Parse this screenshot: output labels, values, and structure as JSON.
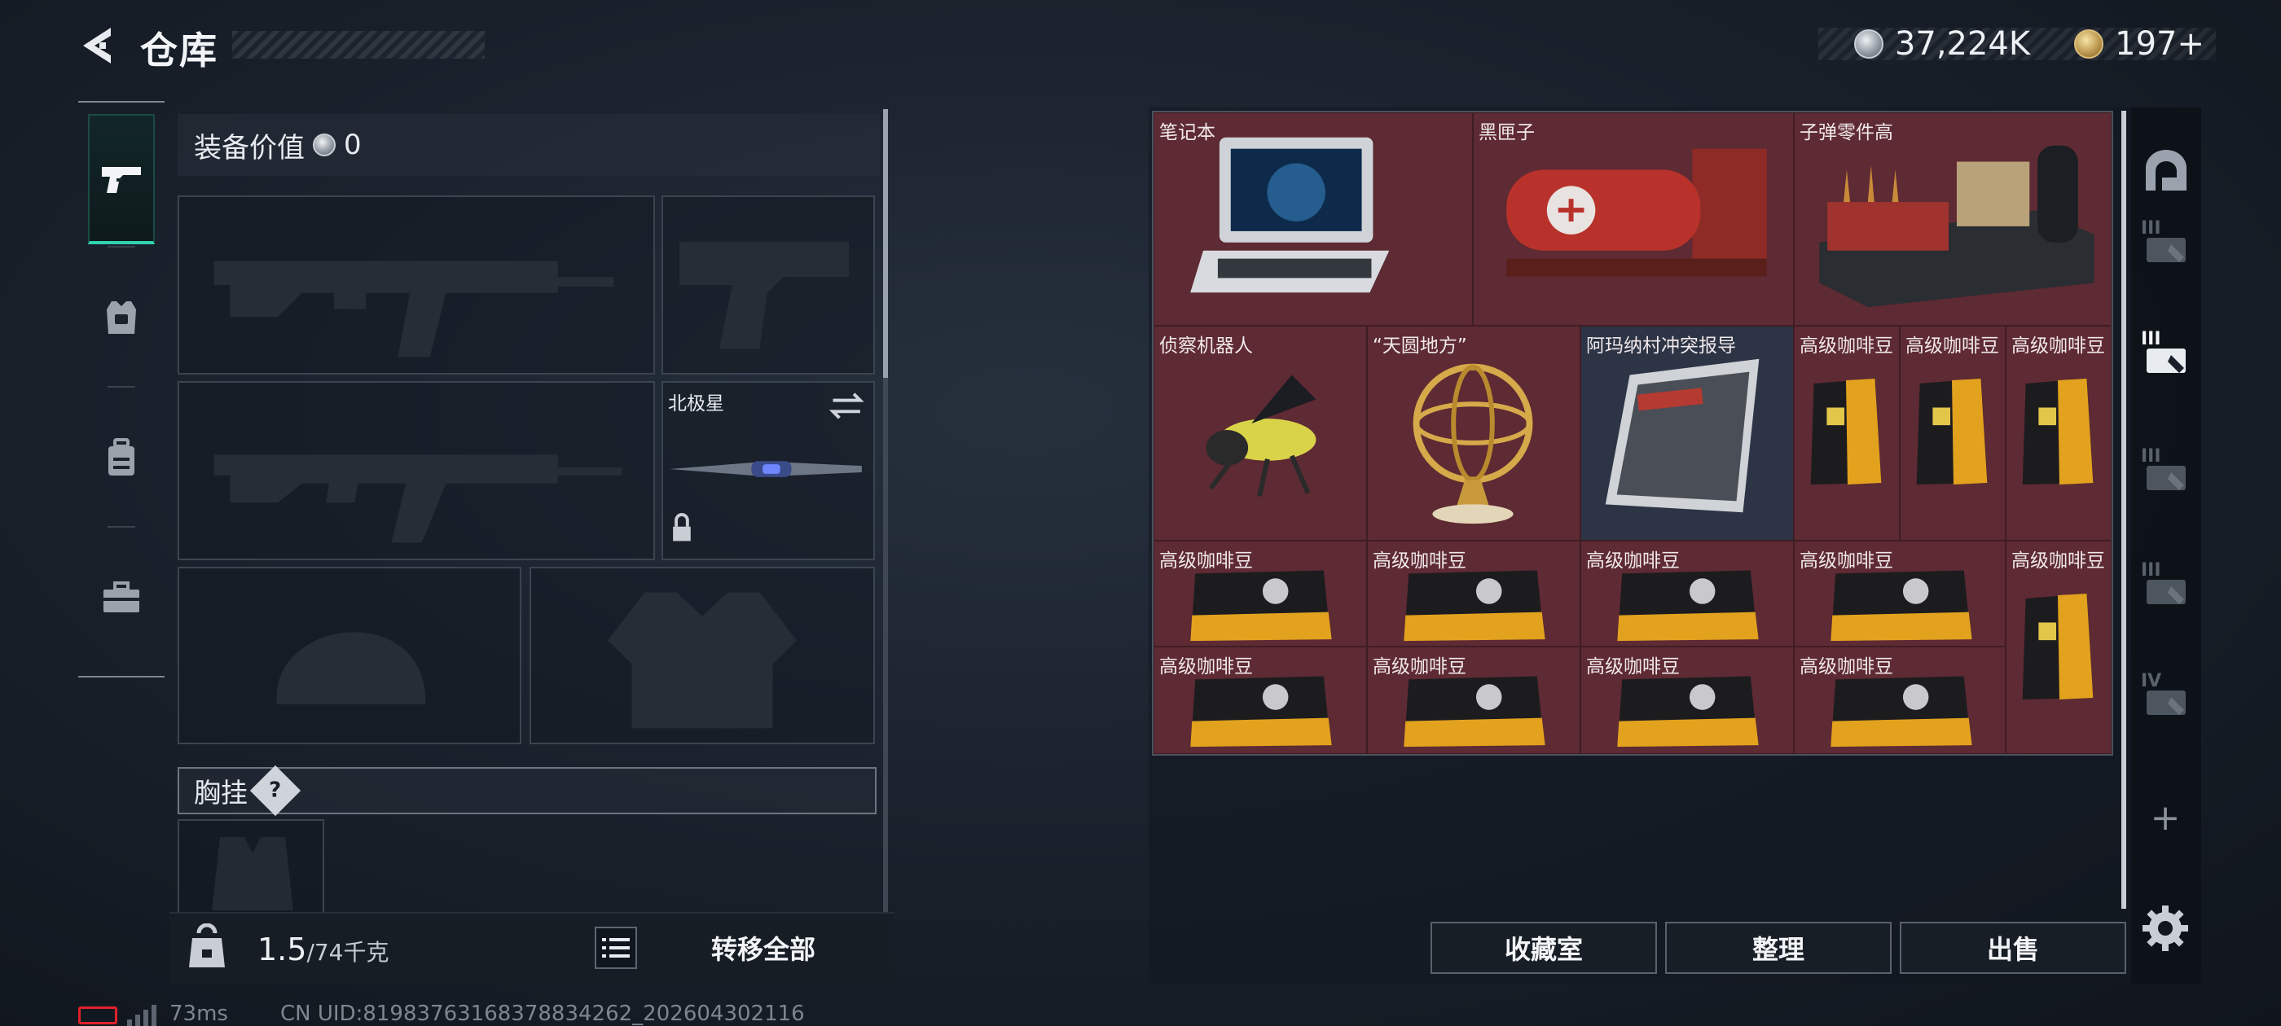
{
  "header": {
    "title": "仓库",
    "currencies": [
      {
        "icon": "silver-coin-icon",
        "value": "37,224K"
      },
      {
        "icon": "gold-coin-icon",
        "value": "197+"
      }
    ]
  },
  "left_nav": [
    {
      "name": "weapons",
      "icon": "pistol-icon",
      "active": true
    },
    {
      "name": "armor",
      "icon": "armor-vest-icon",
      "active": false
    },
    {
      "name": "backpack",
      "icon": "backpack-icon",
      "active": false
    },
    {
      "name": "case",
      "icon": "briefcase-icon",
      "active": false
    }
  ],
  "equipment": {
    "value_label": "装备价值",
    "value": "0",
    "melee_slot_label": "北极星",
    "rig_label": "胸挂",
    "rig_help": "?"
  },
  "weight": {
    "current": "1.5",
    "max": "/74千克"
  },
  "transfer_all_label": "转移全部",
  "stash_items": [
    {
      "label": "笔记本",
      "icon": "laptop-icon",
      "bg": "red"
    },
    {
      "label": "黑匣子",
      "icon": "black-box-icon",
      "bg": "red"
    },
    {
      "label": "子弹零件高",
      "icon": "ammo-parts-icon",
      "bg": "red"
    },
    {
      "label": "侦察机器人",
      "icon": "scout-robot-icon",
      "bg": "red"
    },
    {
      "label": "“天圆地方”",
      "icon": "armillary-sphere-icon",
      "bg": "red"
    },
    {
      "label": "阿玛纳村冲突报导",
      "icon": "magazine-icon",
      "bg": "blue"
    },
    {
      "label": "高级咖啡豆",
      "icon": "coffee-bag-icon",
      "bg": "red"
    },
    {
      "label": "高级咖啡豆",
      "icon": "coffee-bag-icon",
      "bg": "red"
    },
    {
      "label": "高级咖啡豆",
      "icon": "coffee-bag-icon",
      "bg": "red"
    },
    {
      "label": "高级咖啡豆",
      "icon": "coffee-pack-icon",
      "bg": "red"
    },
    {
      "label": "高级咖啡豆",
      "icon": "coffee-pack-icon",
      "bg": "red"
    },
    {
      "label": "高级咖啡豆",
      "icon": "coffee-pack-icon",
      "bg": "red"
    },
    {
      "label": "高级咖啡豆",
      "icon": "coffee-pack-icon",
      "bg": "red"
    },
    {
      "label": "高级咖啡豆",
      "icon": "coffee-bag-icon",
      "bg": "red"
    },
    {
      "label": "高级咖啡豆",
      "icon": "coffee-pack-icon",
      "bg": "red"
    },
    {
      "label": "高级咖啡豆",
      "icon": "coffee-pack-icon",
      "bg": "red"
    },
    {
      "label": "高级咖啡豆",
      "icon": "coffee-pack-icon",
      "bg": "red"
    },
    {
      "label": "高级咖啡豆",
      "icon": "coffee-pack-icon",
      "bg": "red"
    }
  ],
  "right_tabs": [
    {
      "roman": "",
      "icon": "home-door-icon",
      "active": false
    },
    {
      "roman": "III",
      "icon": "storage-tab-icon",
      "active": false
    },
    {
      "roman": "III",
      "icon": "storage-tab-icon",
      "active": true
    },
    {
      "roman": "III",
      "icon": "storage-tab-icon",
      "active": false
    },
    {
      "roman": "III",
      "icon": "storage-tab-icon",
      "active": false
    },
    {
      "roman": "IV",
      "icon": "storage-tab-icon",
      "active": false
    }
  ],
  "add_tab_label": "+",
  "actions": {
    "collection_label": "收藏室",
    "sort_label": "整理",
    "sell_label": "出售"
  },
  "status": {
    "ping": "73ms",
    "uid": "CN UID:8198376316837883426​2_202604302116"
  },
  "colors": {
    "accent": "#2fd3ad",
    "stash_red": "#5e2a33",
    "stash_blue": "#2c3445",
    "battery": "#e2212b"
  }
}
